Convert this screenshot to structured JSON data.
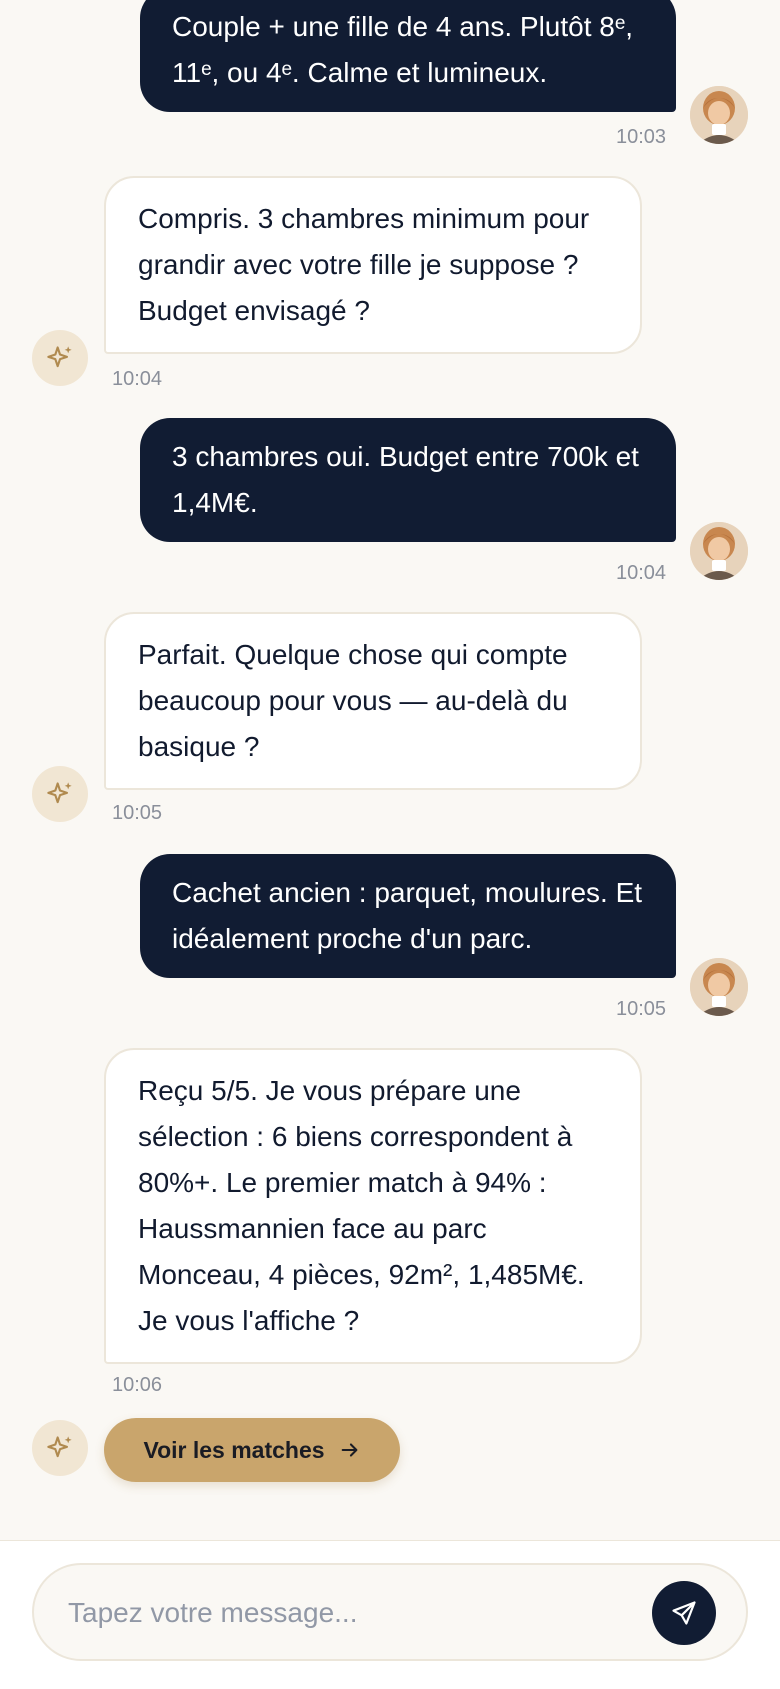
{
  "messages": [
    {
      "role": "user",
      "text": "Couple + une fille de 4 ans. Plutôt 8ᵉ, 11ᵉ, ou 4ᵉ. Calme et lumineux.",
      "time": "10:03"
    },
    {
      "role": "assistant",
      "text": "Compris. 3 chambres minimum pour grandir avec votre fille je suppose ? Budget envisagé ?",
      "time": "10:04"
    },
    {
      "role": "user",
      "text": "3 chambres oui. Budget entre 700k et 1,4M€.",
      "time": "10:04"
    },
    {
      "role": "assistant",
      "text": "Parfait. Quelque chose qui compte beaucoup pour vous — au-delà du basique ?",
      "time": "10:05"
    },
    {
      "role": "user",
      "text": "Cachet ancien : parquet, moulures. Et idéalement proche d'un parc.",
      "time": "10:05"
    },
    {
      "role": "assistant",
      "text": "Reçu 5/5. Je vous prépare une sélection : 6 biens correspondent à 80%+. Le premier match à 94% : Haussmannien face au parc Monceau, 4 pièces, 92m², 1,485M€. Je vous l'affiche ?",
      "time": "10:06"
    }
  ],
  "action": {
    "label": "Voir les matches",
    "icon": "arrow-right-icon"
  },
  "composer": {
    "placeholder": "Tapez votre message..."
  },
  "icons": {
    "assistant": "sparkle-icon",
    "send": "send-icon"
  },
  "colors": {
    "background": "#faf8f4",
    "user_bubble": "#111c33",
    "assistant_bubble": "#ffffff",
    "accent": "#c9a56c",
    "assistant_icon_bg": "#f1e6d3",
    "sparkle": "#b08a4f"
  }
}
